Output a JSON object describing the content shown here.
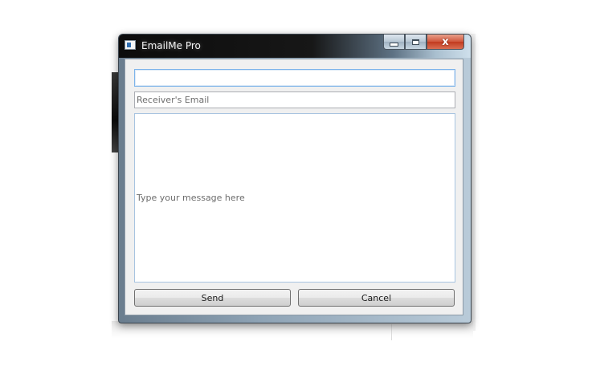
{
  "window": {
    "title": "EmailMe Pro",
    "icon": "app-window-icon",
    "caption": {
      "minimize_icon": "minimize-icon",
      "maximize_icon": "maximize-icon",
      "close_glyph": "x",
      "close_color": "#c7432a"
    }
  },
  "form": {
    "subject_value": "",
    "receiver_placeholder": "Receiver's Email",
    "message_placeholder": "Type your message here",
    "focus_color": "#7eb4ea"
  },
  "buttons": {
    "send_label": "Send",
    "cancel_label": "Cancel"
  }
}
